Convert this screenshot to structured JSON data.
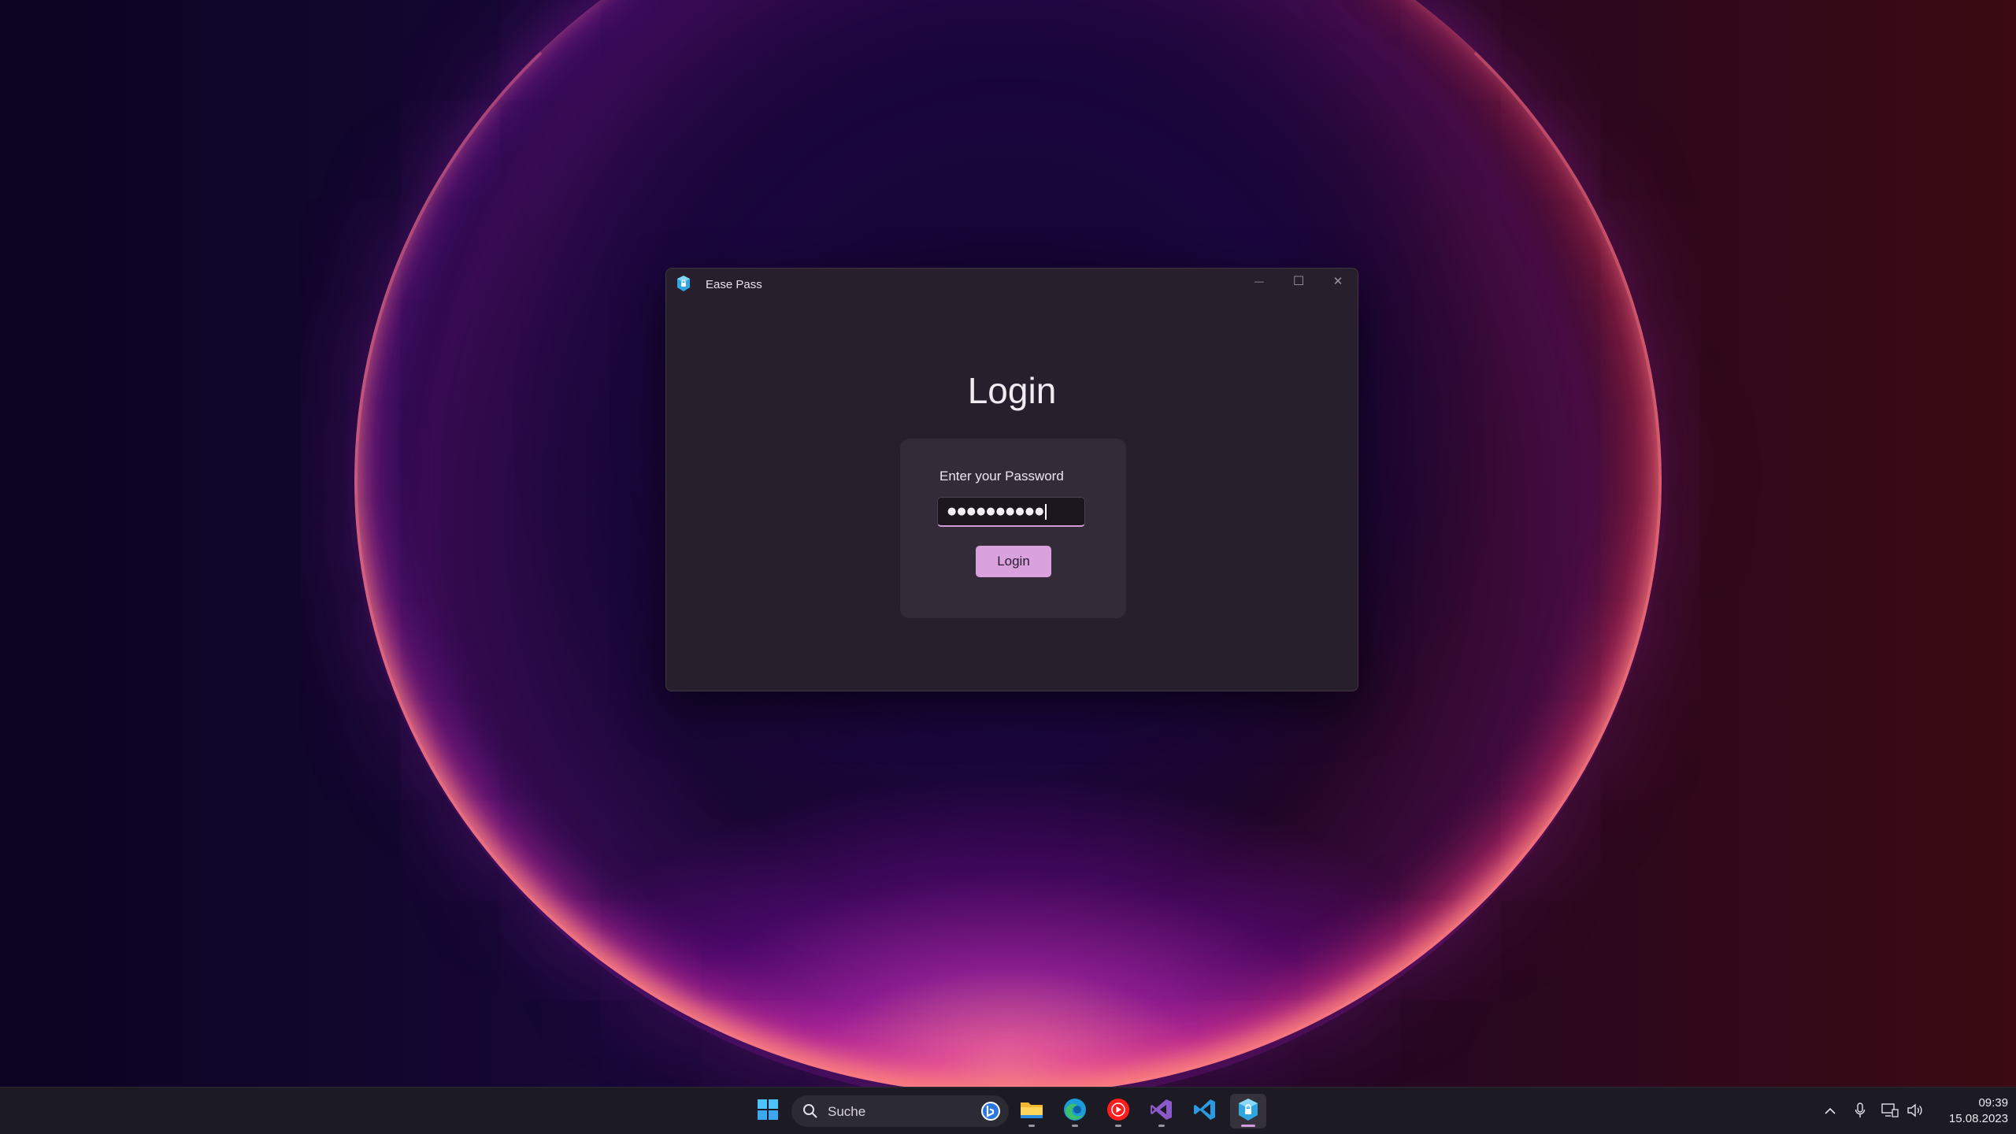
{
  "window": {
    "title": "Ease Pass",
    "minimize_glyph": "—",
    "maximize_glyph": "☐",
    "close_glyph": "✕"
  },
  "login": {
    "heading": "Login",
    "password_label": "Enter your Password",
    "password_value": "●●●●●●●●●●",
    "button_label": "Login"
  },
  "taskbar": {
    "search_placeholder": "Suche",
    "apps": [
      "start-icon",
      "file-explorer-icon",
      "edge-icon",
      "youtube-music-icon",
      "visual-studio-icon",
      "vscode-icon",
      "ease-pass-icon"
    ],
    "active_app": "ease-pass-icon",
    "clock": {
      "time": "09:39",
      "date": "15.08.2023"
    }
  },
  "colors": {
    "accent": "#d9a2de",
    "window_bg": "#271f2b",
    "card_bg": "#342b39",
    "taskbar_bg": "#1c1a22"
  }
}
